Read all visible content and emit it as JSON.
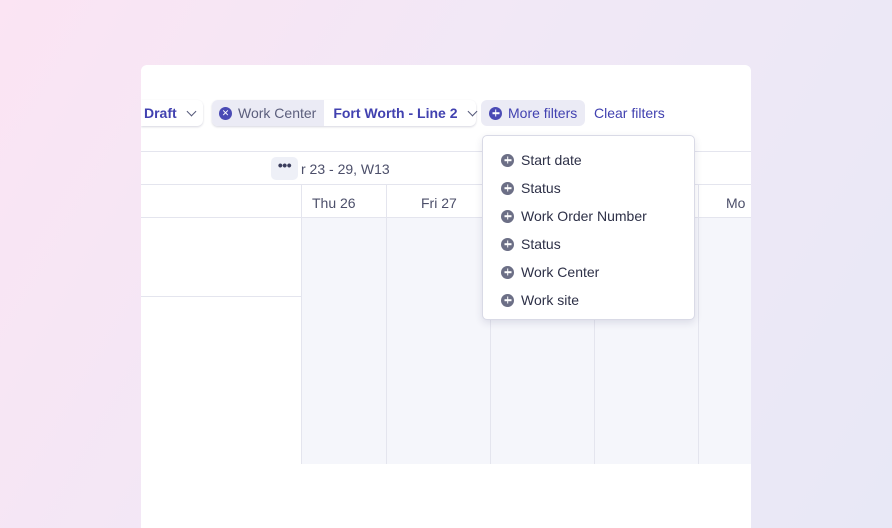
{
  "filters": {
    "status_value": "Draft",
    "work_center_key": "Work Center",
    "work_center_value": "Fort Worth - Line 2",
    "more_filters_label": "More filters",
    "clear_filters_label": "Clear filters"
  },
  "calendar": {
    "more_button": "•••",
    "week_label": "r 23 - 29, W13",
    "days": [
      "Thu 26",
      "Fri 27",
      "Mo"
    ]
  },
  "dropdown": {
    "items": [
      "Start date",
      "Status",
      "Work Order Number",
      "Status",
      "Work Center",
      "Work site"
    ]
  },
  "colors": {
    "accent": "#4141b0",
    "chip_bg": "#ebebf5",
    "grid_bg": "#f5f6fb"
  }
}
